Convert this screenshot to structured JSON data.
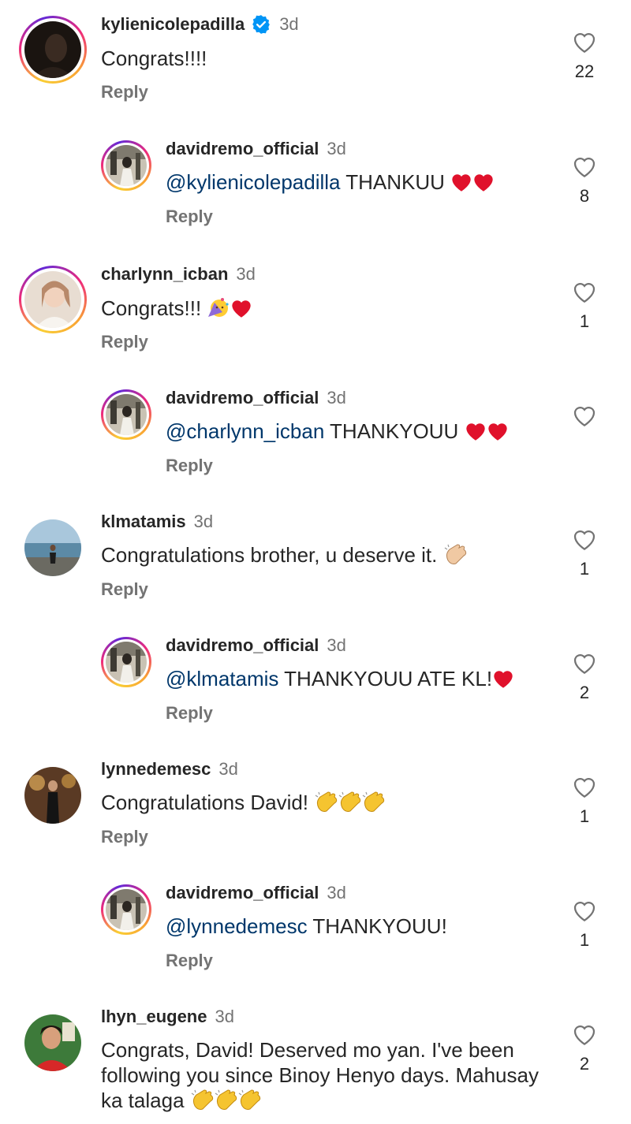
{
  "comments": [
    {
      "username": "kylienicolepadilla",
      "verified": true,
      "time": "3d",
      "text": "Congrats!!!!",
      "reply": "Reply",
      "likes": "22"
    },
    {
      "username": "davidremo_official",
      "time": "3d",
      "mention": "@kylienicolepadilla",
      "text": " THANKUU",
      "reply": "Reply",
      "likes": "8"
    },
    {
      "username": "charlynn_icban",
      "time": "3d",
      "text": "Congrats!!! ",
      "reply": "Reply",
      "likes": "1"
    },
    {
      "username": "davidremo_official",
      "time": "3d",
      "mention": "@charlynn_icban",
      "text": " THANKYOUU",
      "reply": "Reply",
      "likes": ""
    },
    {
      "username": "klmatamis",
      "time": "3d",
      "text": "Congratulations brother, u deserve it. ",
      "reply": "Reply",
      "likes": "1"
    },
    {
      "username": "davidremo_official",
      "time": "3d",
      "mention": "@klmatamis",
      "text": " THANKYOUU ATE KL!",
      "reply": "Reply",
      "likes": "2"
    },
    {
      "username": "lynnedemesc",
      "time": "3d",
      "text": "Congratulations David! ",
      "reply": "Reply",
      "likes": "1"
    },
    {
      "username": "davidremo_official",
      "time": "3d",
      "mention": "@lynnedemesc",
      "text": " THANKYOUU!",
      "reply": "Reply",
      "likes": "1"
    },
    {
      "username": "lhyn_eugene",
      "time": "3d",
      "text": "Congrats, David! Deserved mo yan. I've been following you since Binoy Henyo days. Mahusay ka talaga ",
      "likes": "2"
    }
  ],
  "icons": {
    "like": "heart-outline-icon",
    "verified": "verified-badge-icon",
    "heart_emoji": "red-heart-emoji",
    "party_emoji": "partying-face-emoji",
    "clap_emoji": "clapping-hands-emoji"
  },
  "colors": {
    "username": "#262626",
    "meta": "#737373",
    "mention": "#00376b",
    "verified": "#0095f6",
    "heart": "#e0112b"
  }
}
